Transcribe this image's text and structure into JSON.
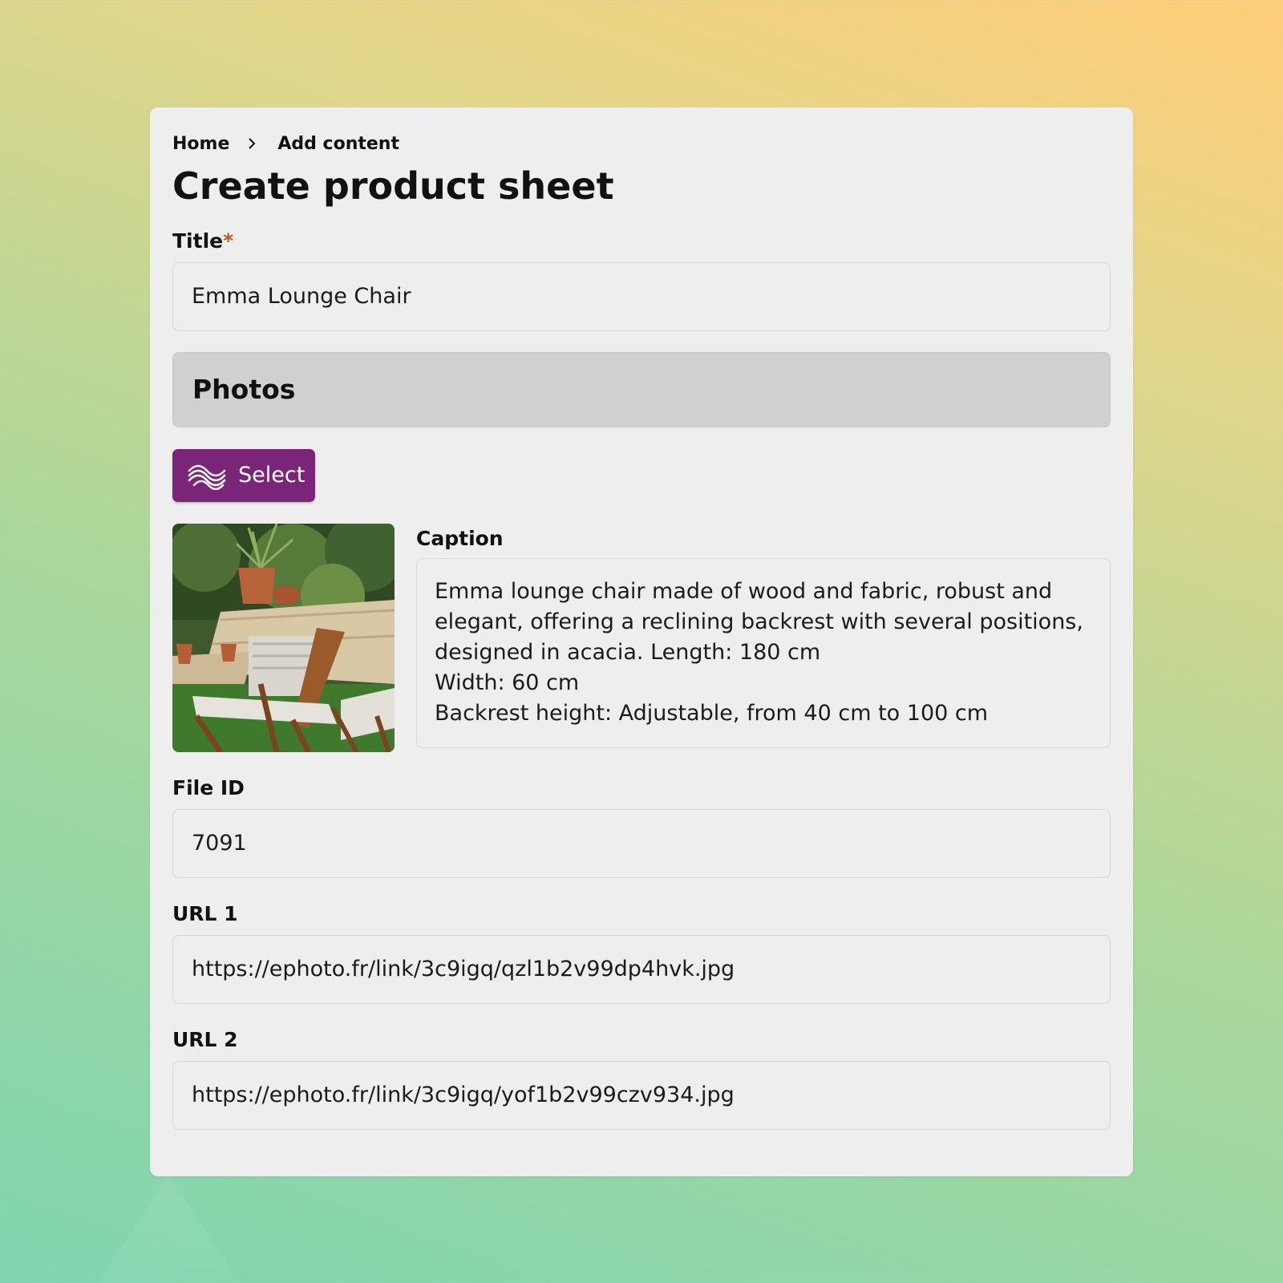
{
  "breadcrumb": {
    "home": "Home",
    "current": "Add content"
  },
  "page_title": "Create product sheet",
  "title_field": {
    "label": "Title",
    "required_mark": "*",
    "value": "Emma Lounge Chair"
  },
  "photos": {
    "section_title": "Photos",
    "select_label": "Select",
    "caption_label": "Caption",
    "caption_text": "Emma lounge chair made of wood and fabric, robust and\nelegant, offering a reclining backrest with several positions,\ndesigned in acacia. Length:  180 cm\nWidth: 60 cm\nBackrest height: Adjustable, from 40 cm to 100 cm"
  },
  "file_id": {
    "label": "File ID",
    "value": "7091"
  },
  "url1": {
    "label": "URL 1",
    "value": "https://ephoto.fr/link/3c9igq/qzl1b2v99dp4hvk.jpg"
  },
  "url2": {
    "label": "URL 2",
    "value": "https://ephoto.fr/link/3c9igq/yof1b2v99czv934.jpg"
  },
  "colors": {
    "accent": "#7a2577",
    "required": "#b65a1c",
    "card": "#eeeeee",
    "section": "#d0d0d0"
  },
  "icons": {
    "breadcrumb_separator": "chevron-right-icon",
    "select_button": "wave-logo-icon"
  }
}
